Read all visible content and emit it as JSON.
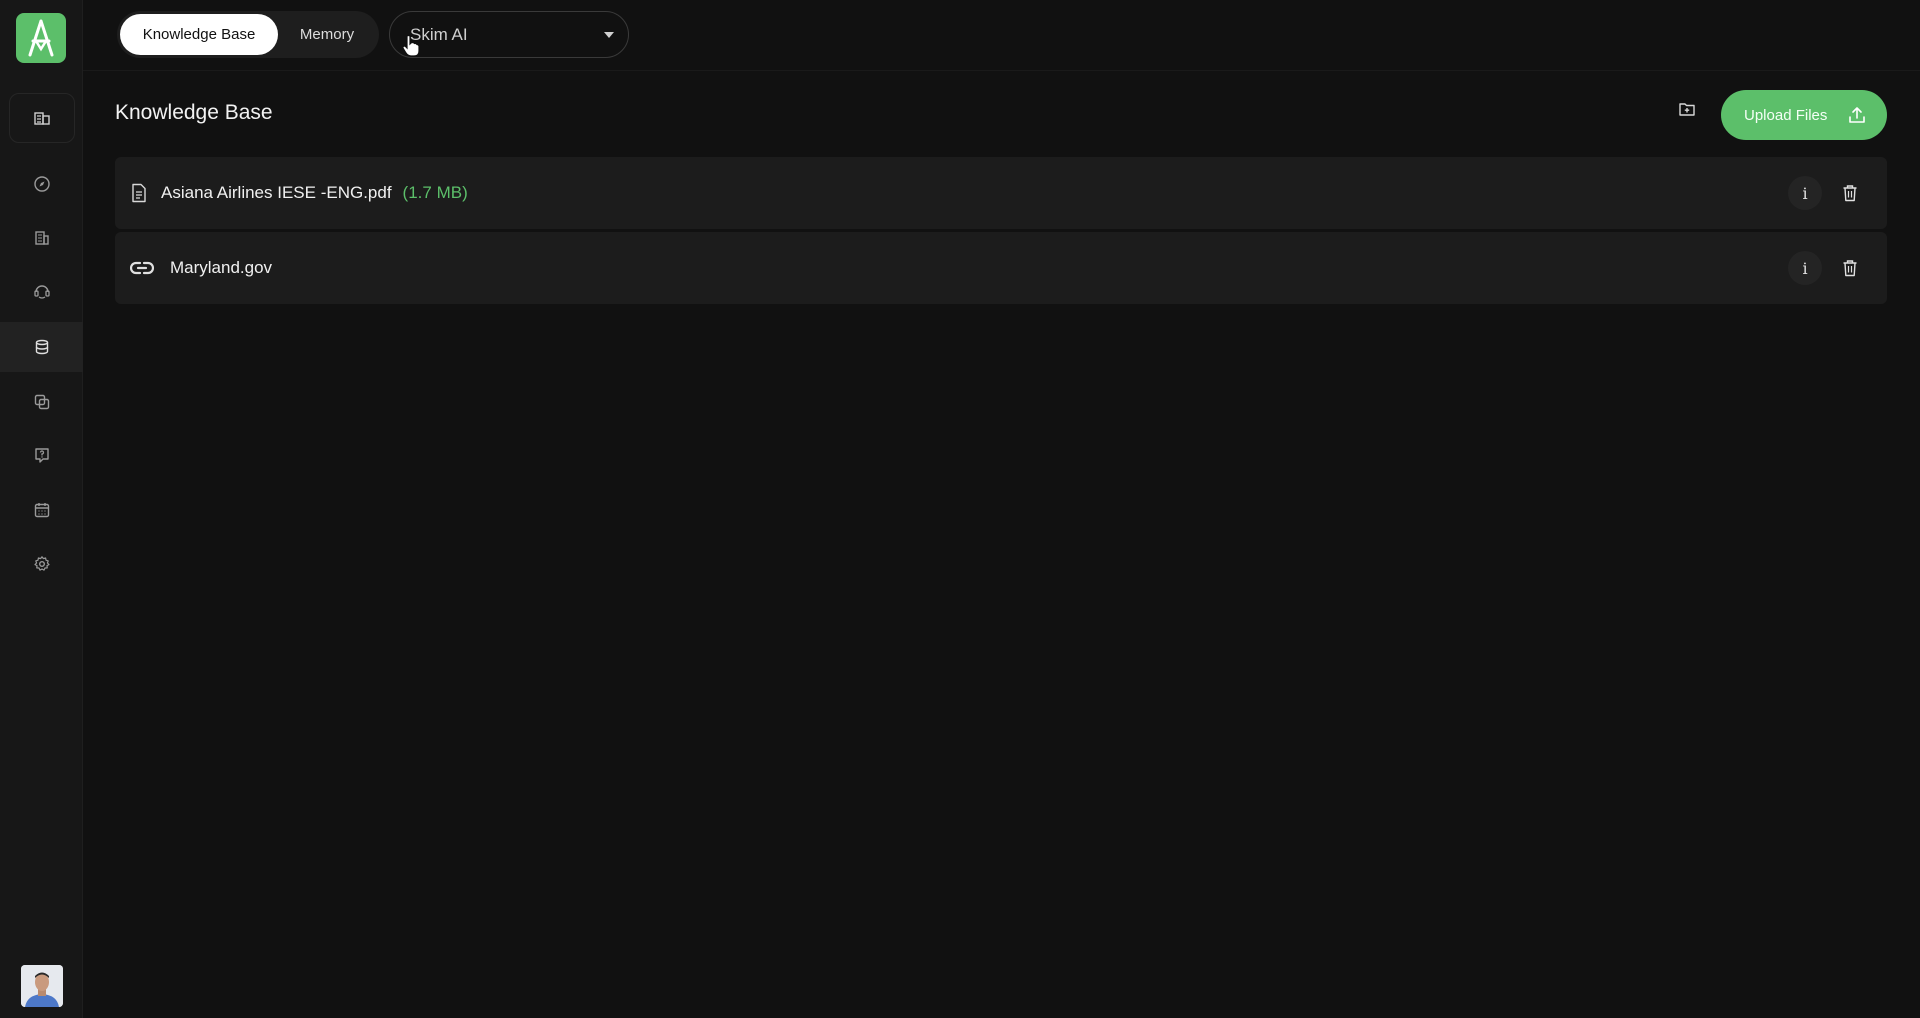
{
  "colors": {
    "accent": "#5cbf6a",
    "background": "#111111",
    "sidebar": "#171717",
    "row": "#1c1c1c"
  },
  "sidebar": {
    "logo_icon": "app-logo-a-icon",
    "items": [
      {
        "icon": "building-list-icon",
        "state": "highlighted"
      },
      {
        "icon": "compass-icon"
      },
      {
        "icon": "buildings-icon"
      },
      {
        "icon": "agent-support-icon"
      },
      {
        "icon": "database-icon",
        "state": "active"
      },
      {
        "icon": "copy-stack-icon"
      },
      {
        "icon": "help-chat-icon"
      },
      {
        "icon": "calendar-icon"
      },
      {
        "icon": "gear-icon"
      }
    ],
    "avatar_icon": "user-avatar"
  },
  "header": {
    "tabs": [
      {
        "label": "Knowledge Base",
        "active": true
      },
      {
        "label": "Memory",
        "active": false
      }
    ],
    "agent_select": {
      "value": "Skim AI"
    }
  },
  "main": {
    "title": "Knowledge Base",
    "upload_label": "Upload Files",
    "items": [
      {
        "icon": "file-document-icon",
        "name": "Asiana Airlines IESE -ENG.pdf",
        "size": "(1.7 MB)"
      },
      {
        "icon": "link-icon",
        "name": "Maryland.gov",
        "size": ""
      }
    ],
    "info_glyph": "i"
  }
}
